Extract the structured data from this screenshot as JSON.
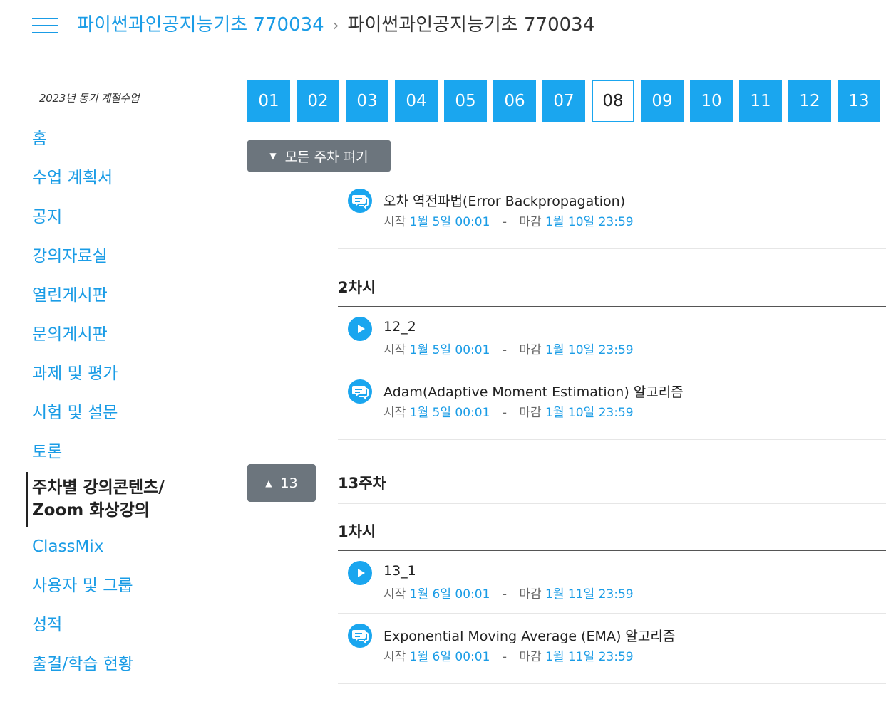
{
  "header": {
    "breadcrumb_link": "파이썬과인공지능기초 770034",
    "breadcrumb_sep": "›",
    "breadcrumb_current": "파이썬과인공지능기초 770034"
  },
  "sidebar": {
    "term": "2023년 동기 계절수업",
    "items": [
      {
        "label": "홈"
      },
      {
        "label": "수업 계획서"
      },
      {
        "label": "공지"
      },
      {
        "label": "강의자료실"
      },
      {
        "label": "열린게시판"
      },
      {
        "label": "문의게시판"
      },
      {
        "label": "과제 및 평가"
      },
      {
        "label": "시험 및 설문"
      },
      {
        "label": "토론"
      },
      {
        "label_line1": "주차별 강의콘텐츠/",
        "label_line2": "Zoom 화상강의"
      },
      {
        "label": "ClassMix"
      },
      {
        "label": "사용자 및 그룹"
      },
      {
        "label": "성적"
      },
      {
        "label": "출결/학습 현황"
      }
    ]
  },
  "weeks": [
    "01",
    "02",
    "03",
    "04",
    "05",
    "06",
    "07",
    "08",
    "09",
    "10",
    "11",
    "12",
    "13"
  ],
  "selected_week": "08",
  "expand_all_label": "모든 주차 펴기",
  "back_to_week_label": "13",
  "colors": {
    "accent": "#1aa6ef",
    "link": "#1a9ce6",
    "button_gray": "#6c757d"
  },
  "meta_labels": {
    "start": "시작",
    "dash": "-",
    "due": "마감"
  },
  "content": {
    "item_top": {
      "type": "discussion-icon",
      "title": "오차 역전파법(Error Backpropagation)",
      "start": "1월 5일 00:01",
      "due": "1월 10일 23:59"
    },
    "section_12_2": {
      "title": "2차시",
      "items": [
        {
          "type": "play-icon",
          "title": "12_2",
          "start": "1월 5일 00:01",
          "due": "1월 10일 23:59"
        },
        {
          "type": "discussion-icon",
          "title": "Adam(Adaptive Moment Estimation) 알고리즘",
          "start": "1월 5일 00:01",
          "due": "1월 10일 23:59"
        }
      ]
    },
    "week13_title": "13주차",
    "section_13_1": {
      "title": "1차시",
      "items": [
        {
          "type": "play-icon",
          "title": "13_1",
          "start": "1월 6일 00:01",
          "due": "1월 11일 23:59"
        },
        {
          "type": "discussion-icon",
          "title": "Exponential Moving Average (EMA) 알고리즘",
          "start": "1월 6일 00:01",
          "due": "1월 11일 23:59"
        }
      ]
    }
  }
}
